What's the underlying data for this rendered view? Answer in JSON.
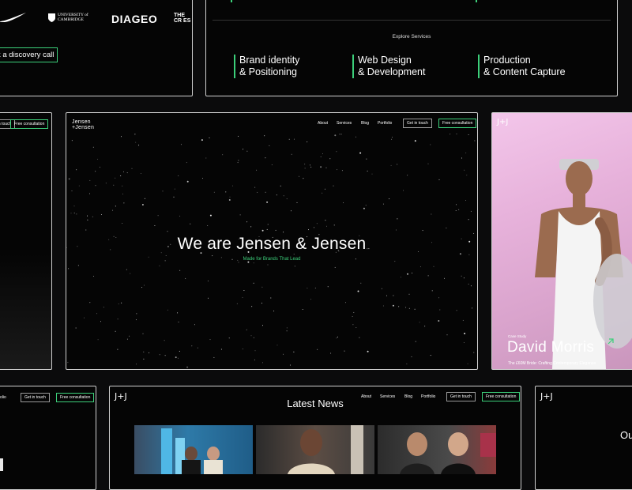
{
  "colors": {
    "accent": "#3ccf7a",
    "frame_border": "#cfcfcf",
    "background": "#0b0b0c"
  },
  "top_left_frame": {
    "logos": [
      "swoosh-logo",
      "UNIVERSITY of CAMBRIDGE",
      "DIAGEO",
      "THE CR ES"
    ],
    "cta_label": "k a discovery call"
  },
  "services_frame": {
    "heading": "Explore Services",
    "services": [
      [
        "Brand identity",
        "& Positioning"
      ],
      [
        "Web Design",
        "& Development"
      ],
      [
        "Production",
        "& Content Capture"
      ]
    ]
  },
  "left_partial_frame": {
    "btn_get_in_touch": "t in touch",
    "btn_free_consult": "Free consultation"
  },
  "hero": {
    "logo_line1": "Jensen",
    "logo_line2": "+Jensen",
    "nav": [
      "About",
      "Services",
      "Blog",
      "Portfolio"
    ],
    "btn_get_in_touch": "Get in touch",
    "btn_free_consult": "Free consultation",
    "title": "We are Jensen & Jensen",
    "tagline": "Made for Brands That Lead"
  },
  "case_study": {
    "logo": "J+J",
    "label": "Case Study",
    "name": "David Morris",
    "caption": "The £60M Bride: Crafting Contemporary Elegance",
    "arrow": "arrow-up-right-icon"
  },
  "bottom_left_frame": {
    "nav_fragment": "olio",
    "btn_get_in_touch": "Get in touch",
    "btn_free_consult": "Free consultation"
  },
  "news": {
    "logo": "J+J",
    "nav": [
      "About",
      "Services",
      "Blog",
      "Portfolio"
    ],
    "btn_get_in_touch": "Get in touch",
    "btn_free_consult": "Free consultation",
    "title": "Latest News"
  },
  "bottom_right_frame": {
    "logo": "J+J",
    "text_fragment": "Ou"
  }
}
